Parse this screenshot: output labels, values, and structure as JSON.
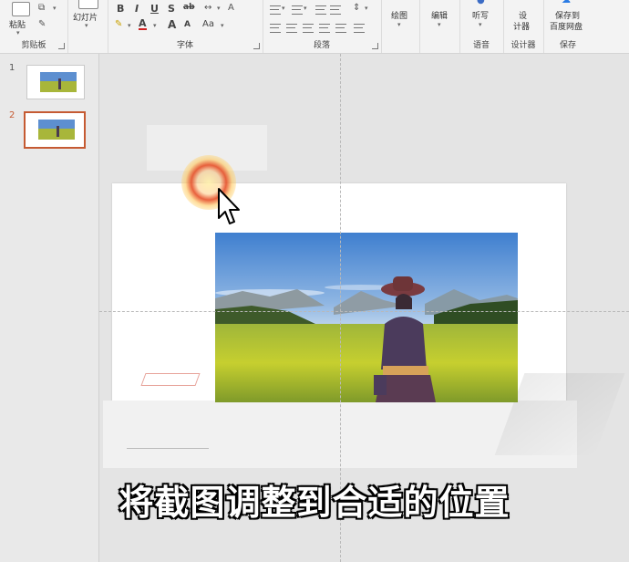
{
  "ribbon": {
    "clipboard": {
      "paste_label": "粘贴",
      "group_label": "剪贴板"
    },
    "slides": {
      "slide_label": "幻灯片",
      "group_label": ""
    },
    "font": {
      "bold": "B",
      "italic": "I",
      "underline": "U",
      "strike": "S",
      "strike2": "ab",
      "font_color": "A",
      "group_label": "字体",
      "grow": "A",
      "shrink": "A",
      "case": "Aa"
    },
    "paragraph": {
      "group_label": "段落"
    },
    "drawing": {
      "label": "绘图"
    },
    "editing": {
      "label": "编辑"
    },
    "voice": {
      "label": "听写",
      "group_label": "语音"
    },
    "designer": {
      "label_line1": "设",
      "label_line2": "计器",
      "group_label": "设计器"
    },
    "save": {
      "label_line1": "保存到",
      "label_line2": "百度网盘",
      "group_label": "保存"
    }
  },
  "thumbnails": [
    {
      "number": "1",
      "selected": false
    },
    {
      "number": "2",
      "selected": true
    }
  ],
  "caption": "将截图调整到合适的位置",
  "colors": {
    "selection_border": "#c55a32",
    "sky_top": "#3f7fcf",
    "field": "#c6cf2f"
  },
  "icons": {
    "paste": "paste-icon",
    "cursor": "mouse-pointer-icon"
  }
}
